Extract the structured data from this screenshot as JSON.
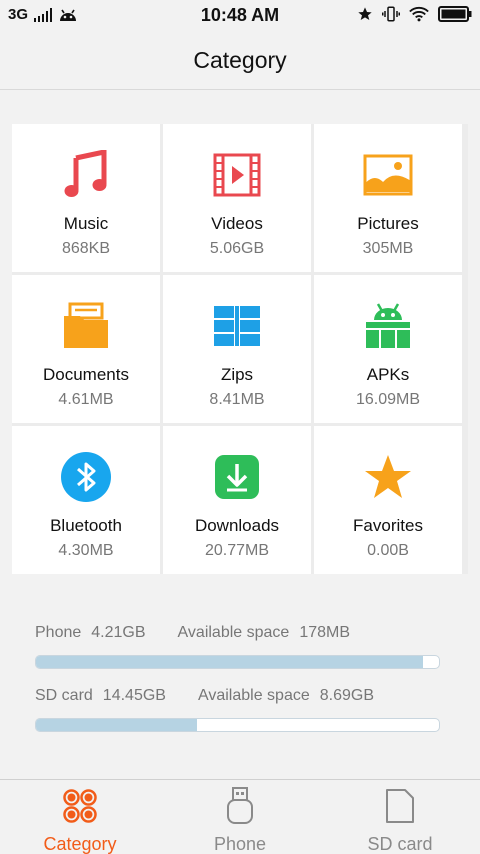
{
  "status_bar": {
    "network": "3G",
    "time": "10:48 AM"
  },
  "header": {
    "title": "Category"
  },
  "categories": [
    {
      "name": "Music",
      "size": "868KB"
    },
    {
      "name": "Videos",
      "size": "5.06GB"
    },
    {
      "name": "Pictures",
      "size": "305MB"
    },
    {
      "name": "Documents",
      "size": "4.61MB"
    },
    {
      "name": "Zips",
      "size": "8.41MB"
    },
    {
      "name": "APKs",
      "size": "16.09MB"
    },
    {
      "name": "Bluetooth",
      "size": "4.30MB"
    },
    {
      "name": "Downloads",
      "size": "20.77MB"
    },
    {
      "name": "Favorites",
      "size": "0.00B"
    }
  ],
  "storage": {
    "phone": {
      "label": "Phone",
      "total": "4.21GB",
      "avail_label": "Available space",
      "avail": "178MB",
      "used_fraction": 0.96
    },
    "sdcard": {
      "label": "SD card",
      "total": "14.45GB",
      "avail_label": "Available space",
      "avail": "8.69GB",
      "used_fraction": 0.4
    }
  },
  "tabs": [
    {
      "label": "Category",
      "active": true
    },
    {
      "label": "Phone",
      "active": false
    },
    {
      "label": "SD card",
      "active": false
    }
  ],
  "colors": {
    "accent": "#f25c19",
    "music": "#e9484f",
    "videos": "#e9484f",
    "pictures": "#f7a21b",
    "documents": "#f7a21b",
    "zips": "#1ea0e6",
    "apks": "#2ebd59",
    "bluetooth": "#18a6ee",
    "downloads": "#2ebd59",
    "favorites": "#f7a21b",
    "bar_fill": "#b6d3e3"
  }
}
